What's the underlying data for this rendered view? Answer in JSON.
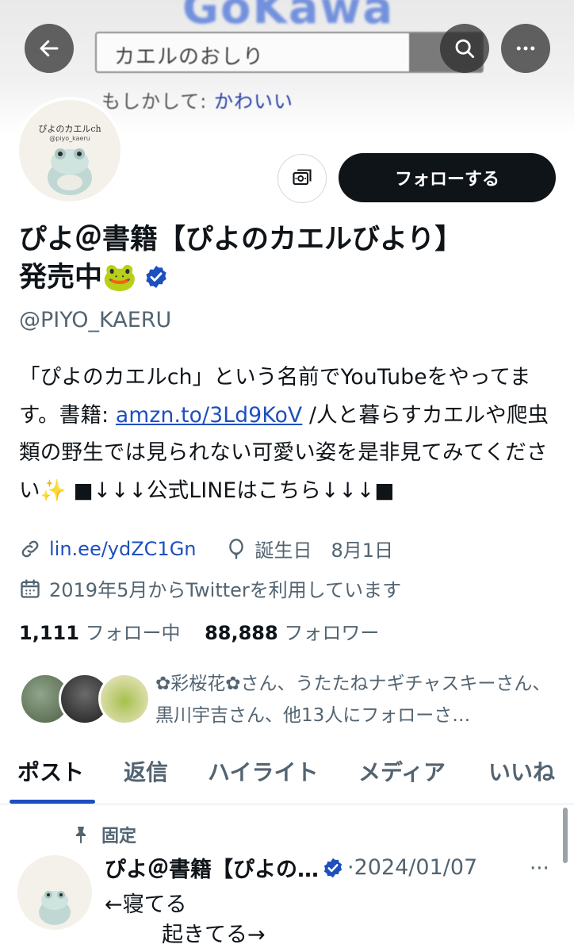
{
  "banner": {
    "logo_peek": "GoKawa",
    "search_query": "カエルのおしり",
    "suggest_prefix": "もしかして: ",
    "suggest_word": "かわいい"
  },
  "avatar": {
    "title": "ぴよのカエルch",
    "handle": "@piyo_kaeru"
  },
  "actions": {
    "follow_label": "フォローする"
  },
  "profile": {
    "name_line1": "ぴよ＠書籍【ぴよのカエルびより】",
    "name_line2": "発売中🐸",
    "handle": "@PIYO_KAERU",
    "bio_part1": "「ぴよのカエルch」という名前でYouTubeをやってます。書籍: ",
    "bio_link": "amzn.to/3Ld9KoV",
    "bio_part2": " /人と暮らすカエルや爬虫類の野生では見られない可愛い姿を是非見てみてください✨ ■↓↓↓公式LINEはこちら↓↓↓■",
    "website": "lin.ee/ydZC1Gn",
    "birthday": "誕生日　8月1日",
    "joined": "2019年5月からTwitterを利用しています",
    "following_count": "1,111",
    "following_label": "フォロー中",
    "followers_count": "88,888",
    "followers_label": "フォロワー",
    "followed_by": "✿彩桜花✿さん、うたたねナギチャスキーさん、黒川宇吉さん、他13人にフォローさ…"
  },
  "tabs": [
    "ポスト",
    "返信",
    "ハイライト",
    "メディア",
    "いいね"
  ],
  "active_tab": "ポスト",
  "post": {
    "pinned_label": "固定",
    "author": "ぴよ＠書籍【ぴよの…",
    "date": "·2024/01/07",
    "line1": "←寝てる",
    "line2": "起きてる→",
    "more": "···"
  },
  "colors": {
    "accent": "#1d4fbf",
    "follow_button": "#0f1419",
    "secondary_text": "#536471"
  }
}
